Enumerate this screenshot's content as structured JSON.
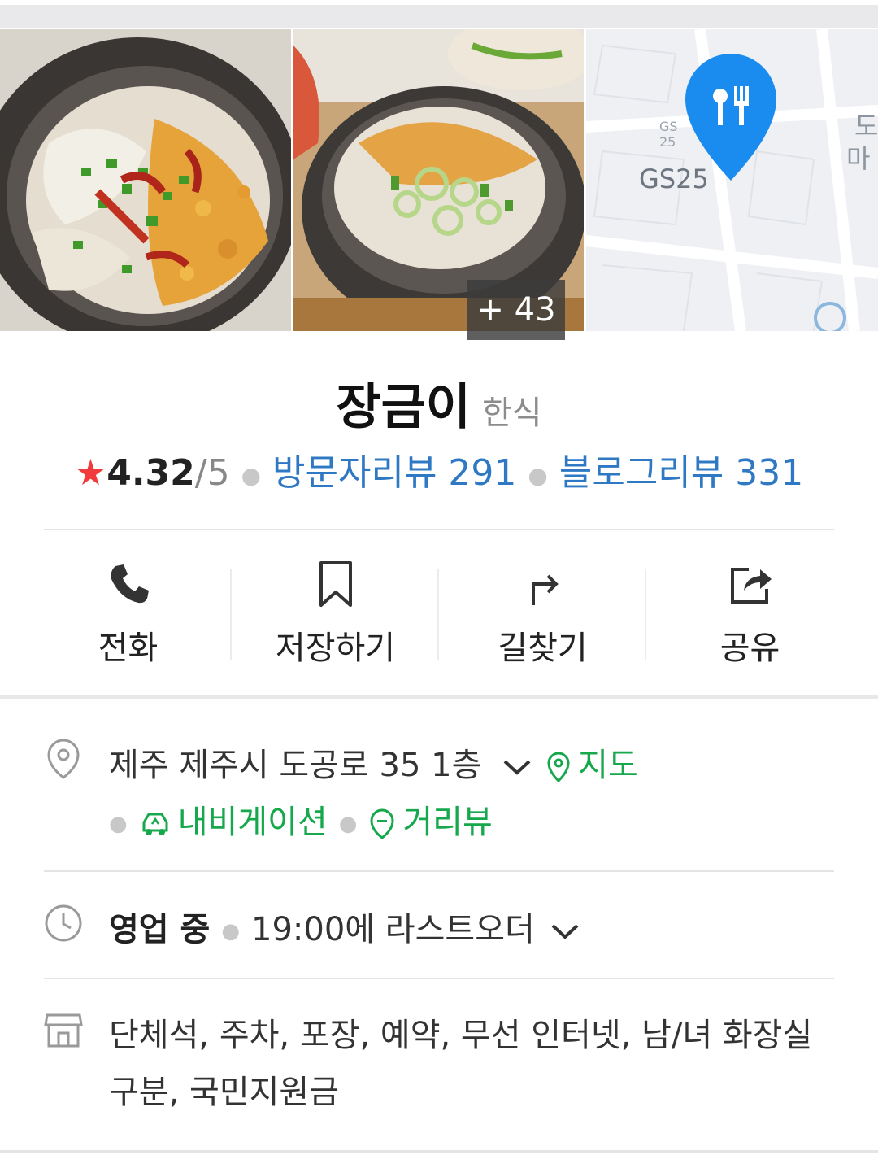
{
  "photos": {
    "more_count": "+ 43",
    "map_labels": {
      "store": "GS25",
      "logo": "GS\n25",
      "edge1": "도",
      "edge2": "마"
    }
  },
  "place": {
    "name": "장금이",
    "category": "한식"
  },
  "rating": {
    "star": "★",
    "score": "4.32",
    "out_of": "/5",
    "visitor_reviews": "방문자리뷰 291",
    "blog_reviews": "블로그리뷰 331"
  },
  "actions": [
    {
      "label": "전화",
      "icon": "phone-icon"
    },
    {
      "label": "저장하기",
      "icon": "bookmark-icon"
    },
    {
      "label": "길찾기",
      "icon": "directions-icon"
    },
    {
      "label": "공유",
      "icon": "share-icon"
    }
  ],
  "address": {
    "text": "제주 제주시 도공로 35 1층",
    "map_link": "지도",
    "navigation_link": "내비게이션",
    "streetview_link": "거리뷰"
  },
  "hours": {
    "status": "영업 중",
    "detail": "19:00에 라스트오더"
  },
  "amenities": {
    "text": "단체석, 주차, 포장, 예약, 무선 인터넷, 남/녀 화장실 구분, 국민지원금"
  },
  "colors": {
    "accent_blue": "#2e78c4",
    "accent_green": "#17a84d",
    "star_red": "#f03c3c",
    "map_pin": "#1a8cf0"
  }
}
